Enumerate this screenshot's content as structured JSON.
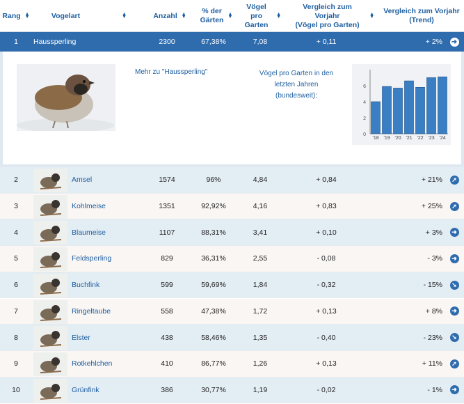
{
  "header": {
    "rang": "Rang",
    "vogelart": "Vogelart",
    "anzahl": "Anzahl",
    "prozent_line1": "% der",
    "prozent_line2": "Gärten",
    "voegel_line1": "Vögel",
    "voegel_line2": "pro Garten",
    "vgl_line1": "Vergleich zum Vorjahr",
    "vgl_line2": "(Vögel pro Garten)",
    "trend_line1": "Vergleich zum Vorjahr",
    "trend_line2": "(Trend)"
  },
  "selected": {
    "rang": "1",
    "name": "Haussperling",
    "anzahl": "2300",
    "prozent": "67,38%",
    "voegel": "7,08",
    "vgl": "+ 0,11",
    "trend": "+ 2%",
    "trend_icon": "arrow-right-icon"
  },
  "detail": {
    "more_link": "Mehr zu \"Haussperling\"",
    "vpg_line1": "Vögel pro Garten in den",
    "vpg_line2": "letzten Jahren",
    "vpg_line3": "(bundesweit):"
  },
  "chart_data": {
    "type": "bar",
    "categories": [
      "18",
      "19",
      "20",
      "21",
      "22",
      "23",
      "24"
    ],
    "values": [
      4.0,
      5.9,
      5.7,
      6.6,
      5.8,
      7.0,
      7.1
    ],
    "ylim": [
      0,
      8
    ],
    "yticks": [
      "0",
      "2",
      "4",
      "6"
    ],
    "bar_color": "#3a7fc3"
  },
  "rows": [
    {
      "rang": "2",
      "name": "Amsel",
      "anzahl": "1574",
      "prozent": "96%",
      "voegel": "4,84",
      "vgl": "+ 0,84",
      "trend": "+ 21%",
      "icon": "arrow-up-right-icon"
    },
    {
      "rang": "3",
      "name": "Kohlmeise",
      "anzahl": "1351",
      "prozent": "92,92%",
      "voegel": "4,16",
      "vgl": "+ 0,83",
      "trend": "+ 25%",
      "icon": "arrow-up-right-icon"
    },
    {
      "rang": "4",
      "name": "Blaumeise",
      "anzahl": "1107",
      "prozent": "88,31%",
      "voegel": "3,41",
      "vgl": "+ 0,10",
      "trend": "+ 3%",
      "icon": "arrow-right-icon"
    },
    {
      "rang": "5",
      "name": "Feldsperling",
      "anzahl": "829",
      "prozent": "36,31%",
      "voegel": "2,55",
      "vgl": "- 0,08",
      "trend": "- 3%",
      "icon": "arrow-right-icon"
    },
    {
      "rang": "6",
      "name": "Buchfink",
      "anzahl": "599",
      "prozent": "59,69%",
      "voegel": "1,84",
      "vgl": "- 0,32",
      "trend": "- 15%",
      "icon": "arrow-down-right-icon"
    },
    {
      "rang": "7",
      "name": "Ringeltaube",
      "anzahl": "558",
      "prozent": "47,38%",
      "voegel": "1,72",
      "vgl": "+ 0,13",
      "trend": "+ 8%",
      "icon": "arrow-right-icon"
    },
    {
      "rang": "8",
      "name": "Elster",
      "anzahl": "438",
      "prozent": "58,46%",
      "voegel": "1,35",
      "vgl": "- 0,40",
      "trend": "- 23%",
      "icon": "arrow-down-right-icon"
    },
    {
      "rang": "9",
      "name": "Rotkehlchen",
      "anzahl": "410",
      "prozent": "86,77%",
      "voegel": "1,26",
      "vgl": "+ 0,13",
      "trend": "+ 11%",
      "icon": "arrow-up-right-icon"
    },
    {
      "rang": "10",
      "name": "Grünfink",
      "anzahl": "386",
      "prozent": "30,77%",
      "voegel": "1,19",
      "vgl": "- 0,02",
      "trend": "- 1%",
      "icon": "arrow-right-icon"
    }
  ]
}
